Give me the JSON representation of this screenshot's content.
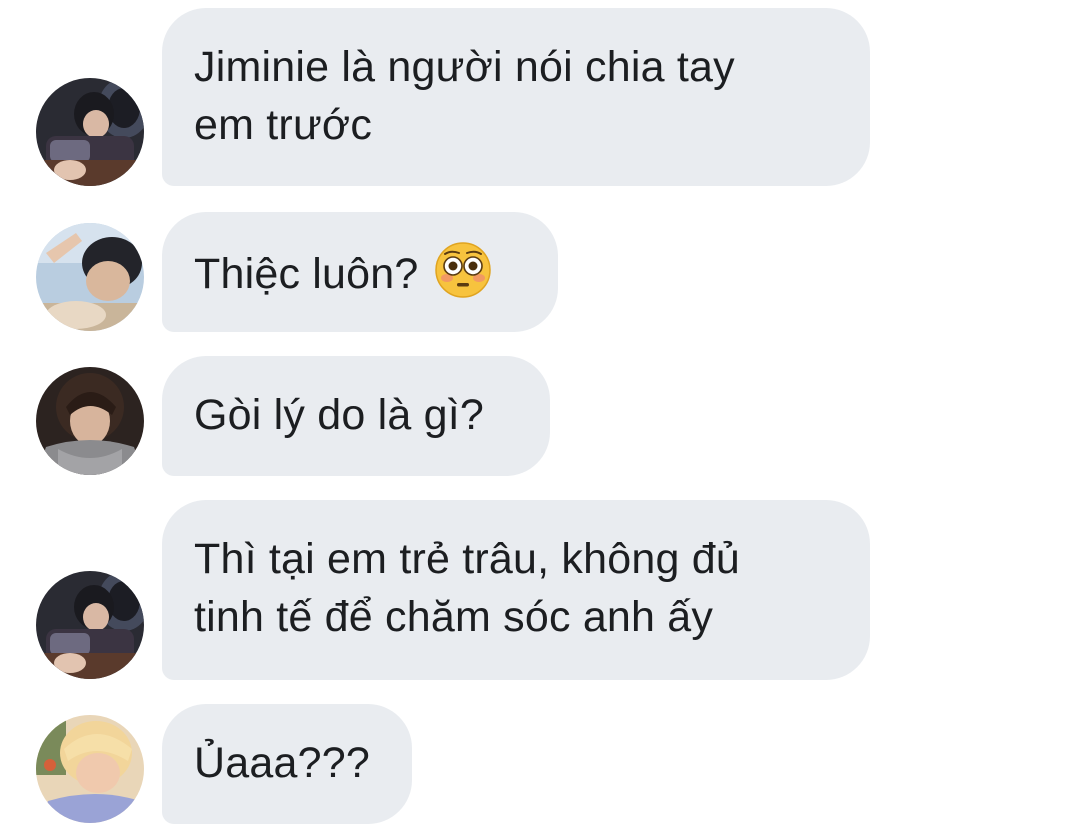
{
  "messages": [
    {
      "avatar_icon": "user-avatar-icon",
      "lines": [
        "Jiminie là người nói chia tay",
        "em trước"
      ]
    },
    {
      "avatar_icon": "user-avatar-icon",
      "lines": [
        "Thiệc luôn?"
      ],
      "emoji_icon": "flushed-face-emoji-icon"
    },
    {
      "avatar_icon": "user-avatar-icon",
      "lines": [
        "Gòi lý do là gì?"
      ]
    },
    {
      "avatar_icon": "user-avatar-icon",
      "lines": [
        "Thì tại em trẻ trâu, không đủ",
        "tinh tế để chăm sóc anh ấy"
      ]
    },
    {
      "avatar_icon": "user-avatar-icon",
      "lines": [
        "Ủaaa???"
      ]
    }
  ],
  "colors": {
    "bubble_background": "#e9ecf0",
    "text": "#1c1e21",
    "page_background": "#ffffff"
  }
}
